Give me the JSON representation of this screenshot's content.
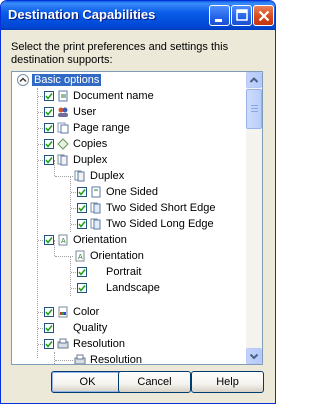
{
  "window": {
    "title": "Destination Capabilities"
  },
  "prompt": "Select the print preferences and settings this destination supports:",
  "tree": {
    "items": [
      {
        "label": "Basic options"
      },
      {
        "label": "Document name"
      },
      {
        "label": "User"
      },
      {
        "label": "Page range"
      },
      {
        "label": "Copies"
      },
      {
        "label": "Duplex"
      },
      {
        "label": "Duplex"
      },
      {
        "label": "One Sided"
      },
      {
        "label": "Two Sided Short Edge"
      },
      {
        "label": "Two Sided Long Edge"
      },
      {
        "label": "Orientation"
      },
      {
        "label": "Orientation"
      },
      {
        "label": "Portrait"
      },
      {
        "label": "Landscape"
      },
      {
        "label": "Color"
      },
      {
        "label": "Quality"
      },
      {
        "label": "Resolution"
      },
      {
        "label": "Resolution"
      }
    ]
  },
  "buttons": {
    "ok": "OK",
    "cancel": "Cancel",
    "help": "Help"
  },
  "colors": {
    "titlebar": "#0054e3",
    "selection": "#316ac5",
    "checkmark": "#21a121"
  }
}
